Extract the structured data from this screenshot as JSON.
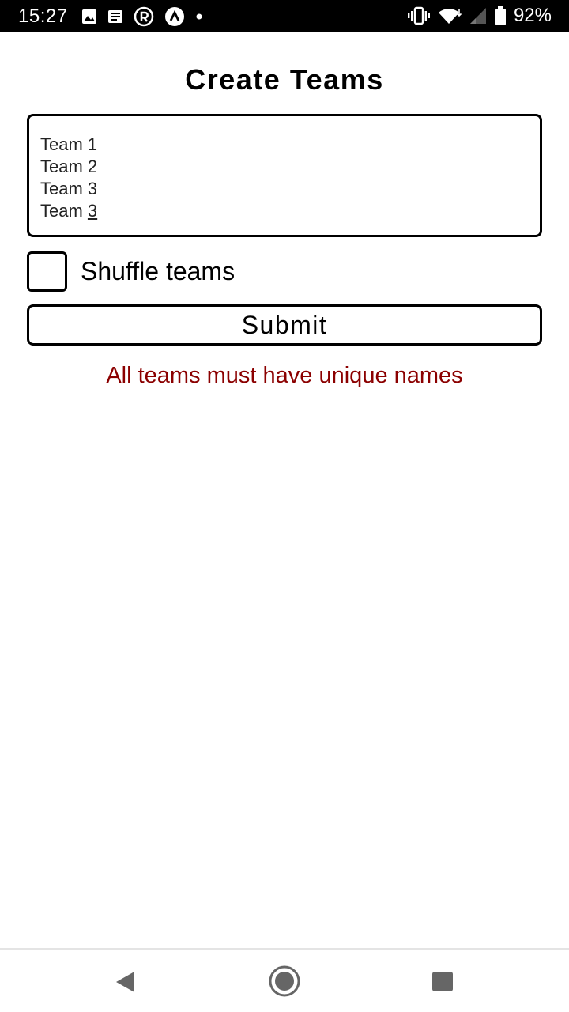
{
  "status_bar": {
    "time": "15:27",
    "battery_percent": "92%",
    "left_icons": [
      "image-icon",
      "news-icon",
      "r-circle-icon",
      "caret-circle-icon",
      "dot-icon"
    ],
    "right_icons": [
      "vibrate-icon",
      "wifi-icon",
      "signal-icon",
      "battery-icon"
    ]
  },
  "main": {
    "title": "Create Teams",
    "teams_input": {
      "lines": [
        "Team 1",
        "Team 2",
        "Team 3"
      ],
      "last_line_prefix": "Team ",
      "last_line_underlined": "3"
    },
    "shuffle": {
      "label": "Shuffle teams",
      "checked": false
    },
    "submit_label": "Submit",
    "error_message": "All teams must have unique names"
  },
  "colors": {
    "error": "#8b0000",
    "status_bar_bg": "#000000",
    "background": "#ffffff"
  },
  "nav_bar": {
    "icons": [
      "back-icon",
      "home-icon",
      "recents-icon"
    ]
  }
}
